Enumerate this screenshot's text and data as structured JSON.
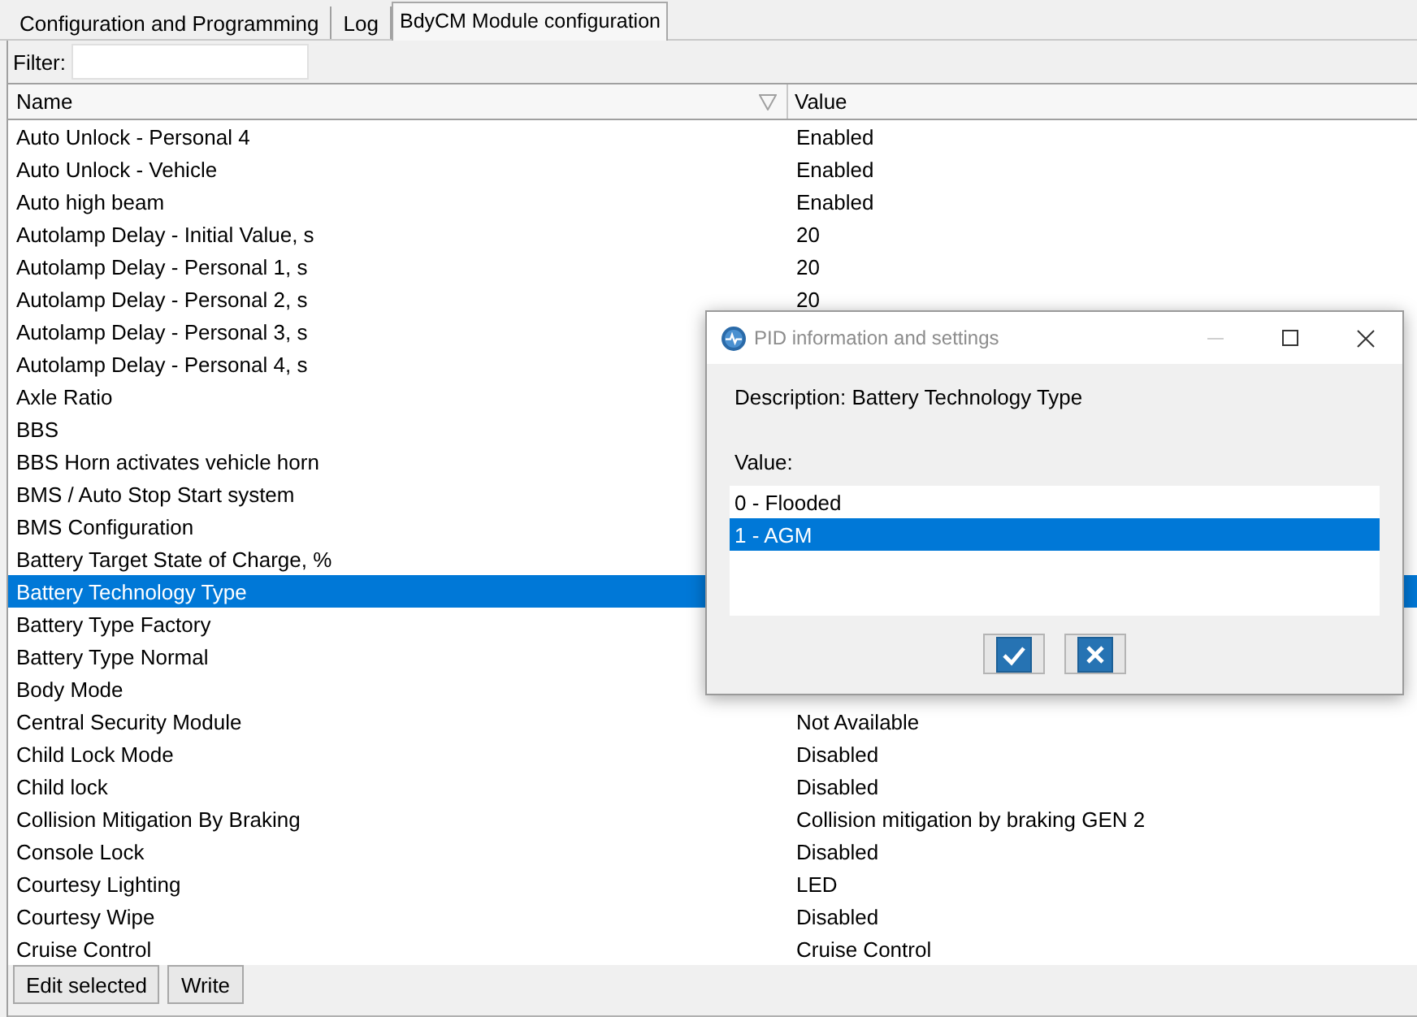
{
  "tabs": [
    {
      "label": "Configuration and Programming",
      "selected": false
    },
    {
      "label": "Log",
      "selected": false
    },
    {
      "label": "BdyCM Module configuration",
      "selected": true
    }
  ],
  "filter": {
    "label": "Filter:"
  },
  "table": {
    "columns": [
      {
        "label": "Name"
      },
      {
        "label": "Value"
      }
    ],
    "rows": [
      {
        "name": "Auto Unlock - Personal 4",
        "value": "Enabled",
        "selected": false
      },
      {
        "name": "Auto Unlock - Vehicle",
        "value": "Enabled",
        "selected": false
      },
      {
        "name": "Auto high beam",
        "value": "Enabled",
        "selected": false
      },
      {
        "name": "Autolamp Delay - Initial Value, s",
        "value": "20",
        "selected": false
      },
      {
        "name": "Autolamp Delay - Personal 1, s",
        "value": "20",
        "selected": false
      },
      {
        "name": "Autolamp Delay - Personal 2, s",
        "value": "20",
        "selected": false
      },
      {
        "name": "Autolamp Delay - Personal 3, s",
        "selected": false
      },
      {
        "name": "Autolamp Delay - Personal 4, s",
        "selected": false
      },
      {
        "name": "Axle Ratio",
        "selected": false
      },
      {
        "name": "BBS",
        "selected": false
      },
      {
        "name": "BBS Horn activates vehicle horn",
        "selected": false
      },
      {
        "name": "BMS / Auto Stop Start system",
        "selected": false
      },
      {
        "name": "BMS Configuration",
        "selected": false
      },
      {
        "name": "Battery Target State of Charge, %",
        "selected": false
      },
      {
        "name": "Battery Technology Type",
        "selected": true
      },
      {
        "name": "Battery Type Factory",
        "selected": false
      },
      {
        "name": "Battery Type Normal",
        "selected": false
      },
      {
        "name": "Body Mode",
        "selected": false
      },
      {
        "name": "Central Security Module",
        "value": "Not Available",
        "selected": false
      },
      {
        "name": "Child Lock Mode",
        "value": "Disabled",
        "selected": false
      },
      {
        "name": "Child lock",
        "value": "Disabled",
        "selected": false
      },
      {
        "name": "Collision Mitigation By Braking",
        "value": "Collision mitigation by braking GEN 2",
        "selected": false
      },
      {
        "name": "Console Lock",
        "value": "Disabled",
        "selected": false
      },
      {
        "name": "Courtesy Lighting",
        "value": "LED",
        "selected": false
      },
      {
        "name": "Courtesy Wipe",
        "value": "Disabled",
        "selected": false
      },
      {
        "name": "Cruise Control",
        "value": "Cruise Control",
        "selected": false
      }
    ]
  },
  "buttons": [
    "Edit selected",
    "Write"
  ],
  "dialog": {
    "title": "PID information and settings",
    "window_controls": [
      {
        "kind": "minimize",
        "disabled": true
      },
      {
        "kind": "maximize",
        "disabled": false
      },
      {
        "kind": "close",
        "disabled": false
      }
    ],
    "description": "Description: Battery Technology Type",
    "value_label": "Value:",
    "options": [
      {
        "label": "0 - Flooded",
        "selected": false
      },
      {
        "label": "1 - AGM",
        "selected": true
      }
    ],
    "buttons": [
      {
        "kind": "ok"
      },
      {
        "kind": "cancel"
      }
    ]
  }
}
